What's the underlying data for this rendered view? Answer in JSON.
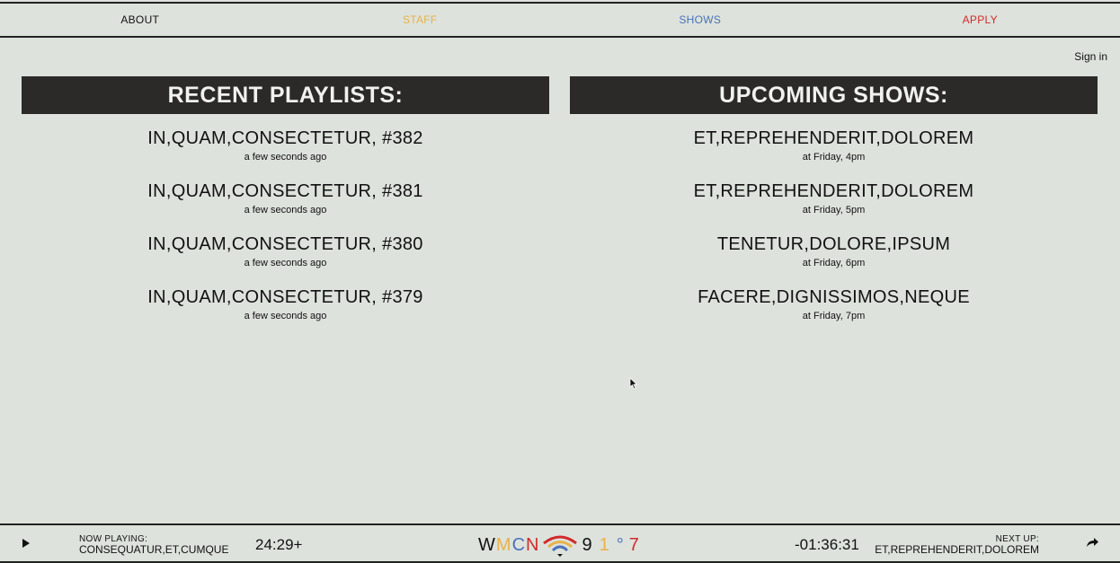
{
  "nav": {
    "items": [
      {
        "label": "ABOUT",
        "color": "#111111"
      },
      {
        "label": "STAFF",
        "color": "#e8b24a"
      },
      {
        "label": "SHOWS",
        "color": "#4a72b8"
      },
      {
        "label": "APPLY",
        "color": "#d12a2a"
      }
    ]
  },
  "auth": {
    "sign_in_label": "Sign in"
  },
  "playlists": {
    "header": "RECENT PLAYLISTS:",
    "items": [
      {
        "title": "IN,QUAM,CONSECTETUR, #382",
        "time": "a few seconds ago"
      },
      {
        "title": "IN,QUAM,CONSECTETUR, #381",
        "time": "a few seconds ago"
      },
      {
        "title": "IN,QUAM,CONSECTETUR, #380",
        "time": "a few seconds ago"
      },
      {
        "title": "IN,QUAM,CONSECTETUR, #379",
        "time": "a few seconds ago"
      }
    ]
  },
  "shows": {
    "header": "UPCOMING SHOWS:",
    "items": [
      {
        "title": "ET,REPREHENDERIT,DOLOREM",
        "time": "at Friday, 4pm"
      },
      {
        "title": "ET,REPREHENDERIT,DOLOREM",
        "time": "at Friday, 5pm"
      },
      {
        "title": "TENETUR,DOLORE,IPSUM",
        "time": "at Friday, 6pm"
      },
      {
        "title": "FACERE,DIGNISSIMOS,NEQUE",
        "time": "at Friday, 7pm"
      }
    ]
  },
  "player": {
    "play_icon": "play-icon",
    "now_playing_label": "NOW PLAYING:",
    "now_playing_track": "CONSEQUATUR,ET,CUMQUE",
    "elapsed": "24:29+",
    "remaining": "-01:36:31",
    "next_up_label": "NEXT UP:",
    "next_up_track": "ET,REPREHENDERIT,DOLOREM",
    "skip_icon": "skip-forward-icon",
    "logo": {
      "letters": [
        {
          "ch": "W",
          "color": "#111111"
        },
        {
          "ch": "M",
          "color": "#e8b24a"
        },
        {
          "ch": "C",
          "color": "#4a72b8"
        },
        {
          "ch": "N",
          "color": "#d12a2a"
        }
      ],
      "digits": [
        {
          "ch": "9",
          "color": "#111111"
        },
        {
          "ch": "1",
          "color": "#e8b24a"
        },
        {
          "ch": "°",
          "color": "#4a72b8"
        },
        {
          "ch": "7",
          "color": "#d12a2a"
        }
      ],
      "wave_colors": [
        "#d12a2a",
        "#e8b24a",
        "#4a72b8"
      ]
    }
  }
}
